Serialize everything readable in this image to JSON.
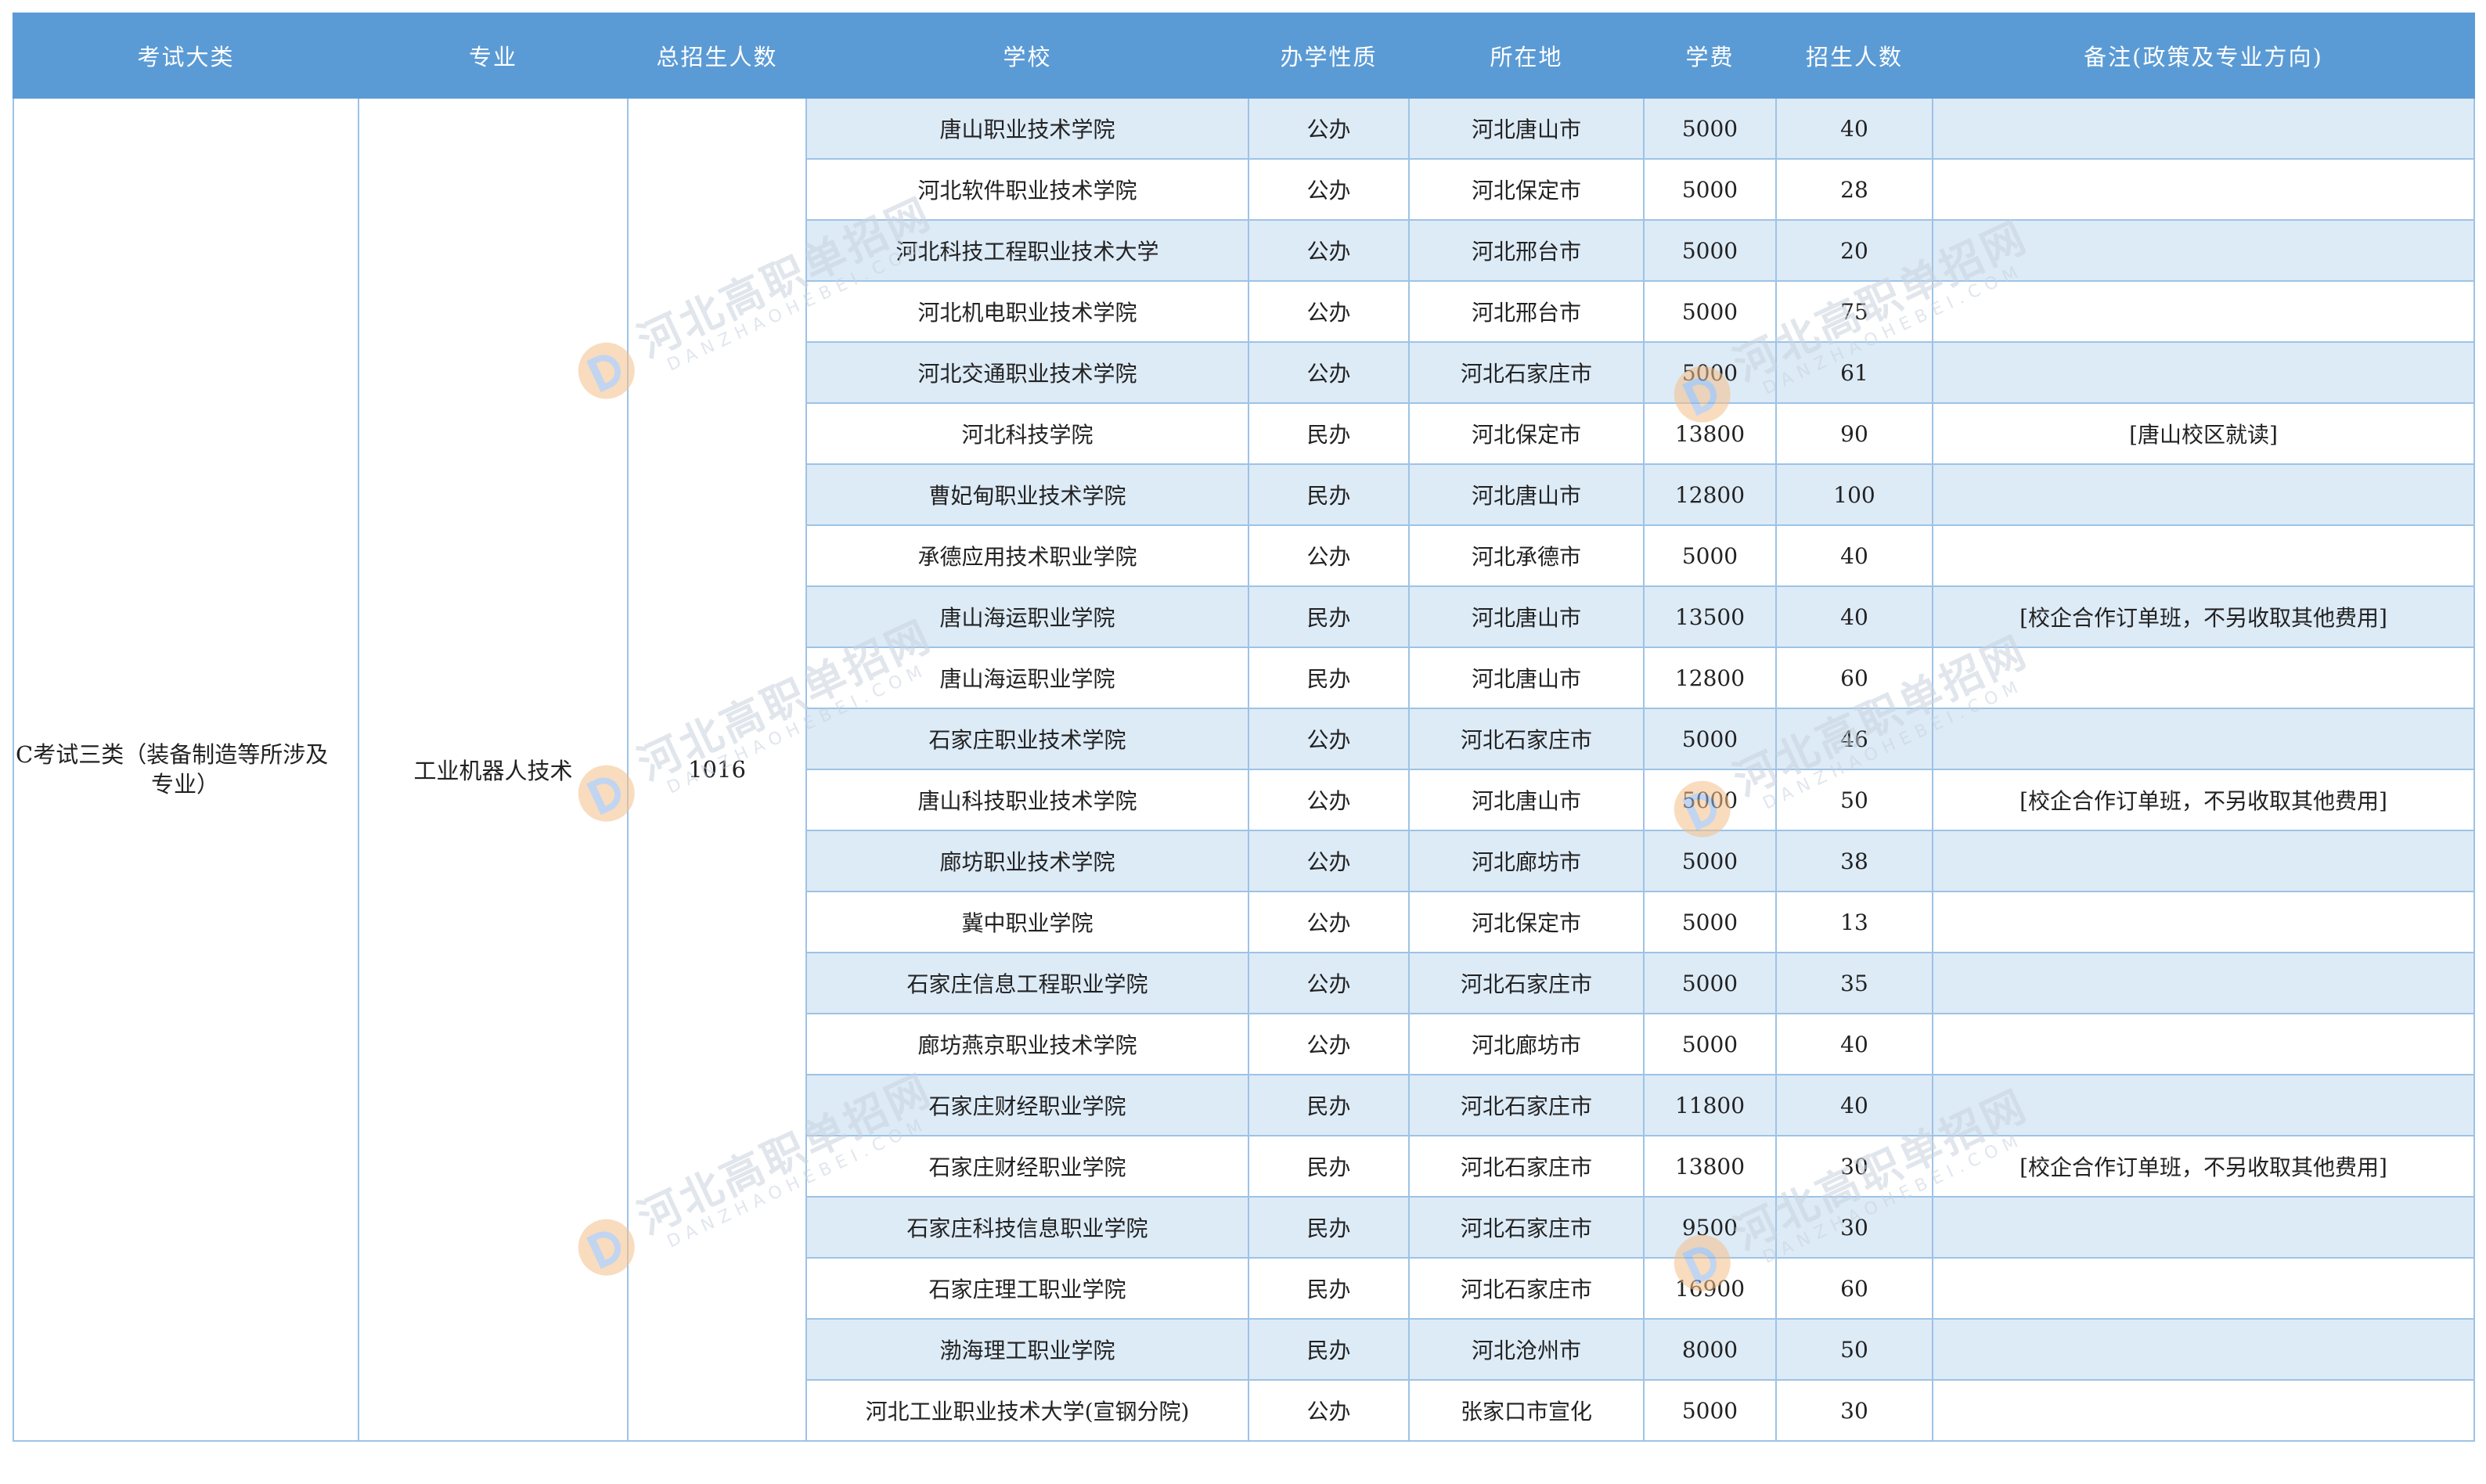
{
  "headers": [
    "考试大类",
    "专业",
    "总招生人数",
    "学校",
    "办学性质",
    "所在地",
    "学费",
    "招生人数",
    "备注(政策及专业方向)"
  ],
  "group": {
    "exam_category_line1": "C考试三类（装备制造等所涉及",
    "exam_category_line2": "专业）",
    "major": "工业机器人技术",
    "total": "1016"
  },
  "rows": [
    {
      "school": "唐山职业技术学院",
      "type": "公办",
      "location": "河北唐山市",
      "fee": "5000",
      "count": "40",
      "note": ""
    },
    {
      "school": "河北软件职业技术学院",
      "type": "公办",
      "location": "河北保定市",
      "fee": "5000",
      "count": "28",
      "note": ""
    },
    {
      "school": "河北科技工程职业技术大学",
      "type": "公办",
      "location": "河北邢台市",
      "fee": "5000",
      "count": "20",
      "note": ""
    },
    {
      "school": "河北机电职业技术学院",
      "type": "公办",
      "location": "河北邢台市",
      "fee": "5000",
      "count": "75",
      "note": ""
    },
    {
      "school": "河北交通职业技术学院",
      "type": "公办",
      "location": "河北石家庄市",
      "fee": "5000",
      "count": "61",
      "note": ""
    },
    {
      "school": "河北科技学院",
      "type": "民办",
      "location": "河北保定市",
      "fee": "13800",
      "count": "90",
      "note": "[唐山校区就读]"
    },
    {
      "school": "曹妃甸职业技术学院",
      "type": "民办",
      "location": "河北唐山市",
      "fee": "12800",
      "count": "100",
      "note": ""
    },
    {
      "school": "承德应用技术职业学院",
      "type": "公办",
      "location": "河北承德市",
      "fee": "5000",
      "count": "40",
      "note": ""
    },
    {
      "school": "唐山海运职业学院",
      "type": "民办",
      "location": "河北唐山市",
      "fee": "13500",
      "count": "40",
      "note": "[校企合作订单班，不另收取其他费用]"
    },
    {
      "school": "唐山海运职业学院",
      "type": "民办",
      "location": "河北唐山市",
      "fee": "12800",
      "count": "60",
      "note": ""
    },
    {
      "school": "石家庄职业技术学院",
      "type": "公办",
      "location": "河北石家庄市",
      "fee": "5000",
      "count": "46",
      "note": ""
    },
    {
      "school": "唐山科技职业技术学院",
      "type": "公办",
      "location": "河北唐山市",
      "fee": "5000",
      "count": "50",
      "note": "[校企合作订单班，不另收取其他费用]"
    },
    {
      "school": "廊坊职业技术学院",
      "type": "公办",
      "location": "河北廊坊市",
      "fee": "5000",
      "count": "38",
      "note": ""
    },
    {
      "school": "冀中职业学院",
      "type": "公办",
      "location": "河北保定市",
      "fee": "5000",
      "count": "13",
      "note": ""
    },
    {
      "school": "石家庄信息工程职业学院",
      "type": "公办",
      "location": "河北石家庄市",
      "fee": "5000",
      "count": "35",
      "note": ""
    },
    {
      "school": "廊坊燕京职业技术学院",
      "type": "公办",
      "location": "河北廊坊市",
      "fee": "5000",
      "count": "40",
      "note": ""
    },
    {
      "school": "石家庄财经职业学院",
      "type": "民办",
      "location": "河北石家庄市",
      "fee": "11800",
      "count": "40",
      "note": ""
    },
    {
      "school": "石家庄财经职业学院",
      "type": "民办",
      "location": "河北石家庄市",
      "fee": "13800",
      "count": "30",
      "note": "[校企合作订单班，不另收取其他费用]"
    },
    {
      "school": "石家庄科技信息职业学院",
      "type": "民办",
      "location": "河北石家庄市",
      "fee": "9500",
      "count": "30",
      "note": ""
    },
    {
      "school": "石家庄理工职业学院",
      "type": "民办",
      "location": "河北石家庄市",
      "fee": "16900",
      "count": "60",
      "note": ""
    },
    {
      "school": "渤海理工职业学院",
      "type": "民办",
      "location": "河北沧州市",
      "fee": "8000",
      "count": "50",
      "note": ""
    },
    {
      "school": "河北工业职业技术大学(宣钢分院)",
      "type": "公办",
      "location": "张家口市宣化",
      "fee": "5000",
      "count": "30",
      "note": ""
    }
  ],
  "watermark": {
    "cn": "河北高职单招网",
    "en": "DANZHAOHEBEI.COM",
    "logo_icon": "d-logo-icon"
  },
  "colors": {
    "header_bg": "#5b9bd5",
    "row_shade": "#ddebf7",
    "border": "#9dc3e6"
  }
}
